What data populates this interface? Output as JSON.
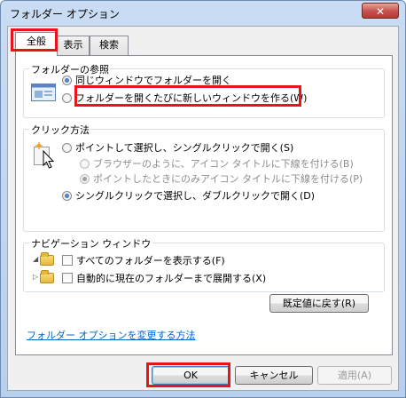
{
  "window": {
    "title": "フォルダー オプション",
    "close_label": "✕"
  },
  "tabs": [
    {
      "label": "全般"
    },
    {
      "label": "表示"
    },
    {
      "label": "検索"
    }
  ],
  "browse_group": {
    "title": "フォルダーの参照",
    "option_same": "同じウィンドウでフォルダーを開く",
    "option_new": "フォルダーを開くたびに新しいウィンドウを作る(W)"
  },
  "click_group": {
    "title": "クリック方法",
    "option_single": "ポイントして選択し、シングルクリックで開く(S)",
    "sub_browser": "ブラウザーのように、アイコン タイトルに下線を付ける(B)",
    "sub_point": "ポイントしたときにのみアイコン タイトルに下線を付ける(P)",
    "option_double": "シングルクリックで選択し、ダブルクリックで開く(D)"
  },
  "nav_group": {
    "title": "ナビゲーション ウィンドウ",
    "show_all": "すべてのフォルダーを表示する(F)",
    "auto_expand": "自動的に現在のフォルダーまで展開する(X)"
  },
  "buttons": {
    "restore": "既定値に戻す(R)",
    "ok": "OK",
    "cancel": "キャンセル",
    "apply": "適用(A)"
  },
  "help_link": "フォルダー オプションを変更する方法",
  "colors": {
    "highlight": "#e8141c",
    "link": "#0066cc"
  },
  "state": {
    "active_tab": "全般",
    "browse_selected": "option_same",
    "click_selected": "option_double",
    "show_all_checked": false,
    "auto_expand_checked": false
  }
}
